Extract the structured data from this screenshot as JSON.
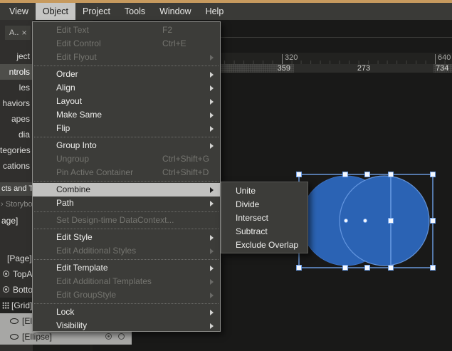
{
  "window": {
    "accent_color": "#C79A5E"
  },
  "menubar": {
    "items": [
      {
        "label": "View",
        "open": false
      },
      {
        "label": "Object",
        "open": true
      },
      {
        "label": "Project",
        "open": false
      },
      {
        "label": "Tools",
        "open": false
      },
      {
        "label": "Window",
        "open": false
      },
      {
        "label": "Help",
        "open": false
      }
    ]
  },
  "assets_panel": {
    "tab_label": "A..",
    "close_glyph": "×",
    "visible_items": [
      {
        "label": "ject",
        "selected": false
      },
      {
        "label": "ntrols",
        "selected": true
      },
      {
        "label": "les",
        "selected": false
      },
      {
        "label": "haviors",
        "selected": false
      },
      {
        "label": "apes",
        "selected": false
      },
      {
        "label": "dia",
        "selected": false
      },
      {
        "label": "tegories",
        "selected": false
      },
      {
        "label": "cations",
        "selected": false
      }
    ]
  },
  "objects_panel": {
    "header_fragment": "cts and T",
    "storyboard_fragment": "› Storybo",
    "breadcrumb_fragment": "age]",
    "rows": [
      {
        "icon": "none",
        "label": "[Page]",
        "selected": false,
        "indent": 10,
        "grid_row": false
      },
      {
        "icon": "eye",
        "label": "TopAp",
        "selected": false,
        "indent": 18,
        "grid_row": false
      },
      {
        "icon": "eye",
        "label": "Botto",
        "selected": false,
        "indent": 18,
        "grid_row": false
      },
      {
        "icon": "grid",
        "label": "[Grid]",
        "selected": false,
        "indent": 16,
        "grid_row": true
      },
      {
        "icon": "ellipse",
        "label": "[El",
        "selected": true,
        "indent": 31,
        "grid_row": false
      },
      {
        "icon": "ellipse",
        "label": "[Ellipse]",
        "selected": true,
        "indent": 31,
        "grid_row": false,
        "trailing_icons": [
          "dotcircle",
          "circle"
        ]
      }
    ]
  },
  "object_menu": {
    "items": [
      {
        "label": "Edit Text",
        "shortcut": "F2",
        "disabled": true
      },
      {
        "label": "Edit Control",
        "shortcut": "Ctrl+E",
        "disabled": true
      },
      {
        "label": "Edit Flyout",
        "submenu": true,
        "disabled": true
      },
      {
        "separator": true
      },
      {
        "label": "Order",
        "submenu": true
      },
      {
        "label": "Align",
        "submenu": true
      },
      {
        "label": "Layout",
        "submenu": true
      },
      {
        "label": "Make Same",
        "submenu": true
      },
      {
        "label": "Flip",
        "submenu": true
      },
      {
        "separator": true
      },
      {
        "label": "Group Into",
        "submenu": true
      },
      {
        "label": "Ungroup",
        "shortcut": "Ctrl+Shift+G",
        "disabled": true
      },
      {
        "label": "Pin Active Container",
        "shortcut": "Ctrl+Shift+D",
        "disabled": true
      },
      {
        "separator": true
      },
      {
        "label": "Combine",
        "submenu": true,
        "highlighted": true
      },
      {
        "label": "Path",
        "submenu": true
      },
      {
        "separator": true
      },
      {
        "label": "Set Design-time DataContext...",
        "disabled": true
      },
      {
        "separator": true
      },
      {
        "label": "Edit Style",
        "submenu": true
      },
      {
        "label": "Edit Additional Styles",
        "submenu": true,
        "disabled": true
      },
      {
        "separator": true
      },
      {
        "label": "Edit Template",
        "submenu": true
      },
      {
        "label": "Edit Additional Templates",
        "submenu": true,
        "disabled": true
      },
      {
        "label": "Edit GroupStyle",
        "submenu": true,
        "disabled": true
      },
      {
        "separator": true
      },
      {
        "label": "Lock",
        "submenu": true
      },
      {
        "label": "Visibility",
        "submenu": true
      }
    ]
  },
  "combine_submenu": {
    "items": [
      {
        "label": "Unite"
      },
      {
        "label": "Divide"
      },
      {
        "label": "Intersect"
      },
      {
        "label": "Subtract"
      },
      {
        "label": "Exclude Overlap"
      }
    ]
  },
  "ruler": {
    "tick_labels": [
      {
        "text": "320"
      },
      {
        "text": "640"
      }
    ]
  },
  "measure_bar": {
    "segments": [
      {
        "text": "359"
      },
      {
        "text": "273"
      },
      {
        "text": "734"
      }
    ]
  },
  "artboard": {
    "shape_fill": "#2B63B4",
    "shape_edge": "#3B6FC0",
    "selection_color": "#6FA0E8",
    "handle_fill": "#F5F8FD"
  }
}
